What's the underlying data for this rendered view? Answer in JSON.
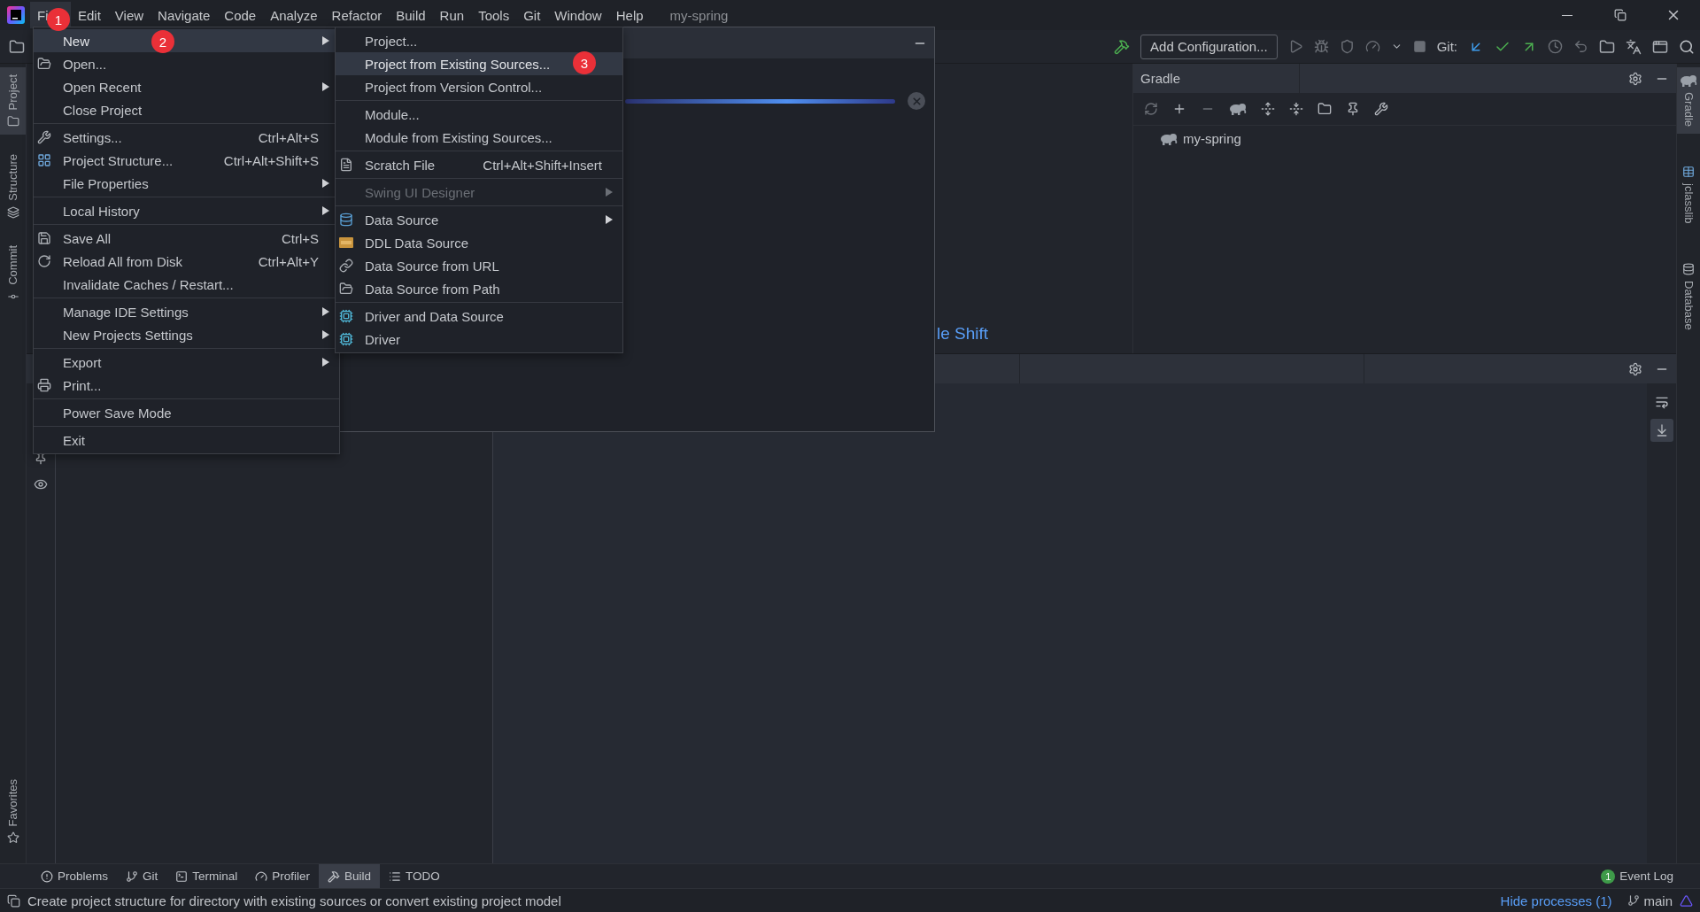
{
  "window": {
    "title": "my-spring"
  },
  "menu_bar": [
    {
      "label": "Fi",
      "selected": true
    },
    {
      "label": "Edit",
      "selected": false
    },
    {
      "label": "View",
      "selected": false
    },
    {
      "label": "Navigate",
      "selected": false
    },
    {
      "label": "Code",
      "selected": false
    },
    {
      "label": "Analyze",
      "selected": false
    },
    {
      "label": "Refactor",
      "selected": false
    },
    {
      "label": "Build",
      "selected": false
    },
    {
      "label": "Run",
      "selected": false
    },
    {
      "label": "Tools",
      "selected": false
    },
    {
      "label": "Git",
      "selected": false
    },
    {
      "label": "Window",
      "selected": false
    },
    {
      "label": "Help",
      "selected": false
    }
  ],
  "toolbar": {
    "run_config": "Add Configuration...",
    "vcs_label": "Git:"
  },
  "left_stripe": [
    {
      "label": "Project",
      "selected": true
    },
    {
      "label": "Structure",
      "selected": false
    },
    {
      "label": "Commit",
      "selected": false
    },
    {
      "label": "Favorites",
      "selected": false
    }
  ],
  "right_stripe": [
    {
      "label": "Gradle",
      "selected": true
    },
    {
      "label": "jclasslib",
      "selected": false
    },
    {
      "label": "Database",
      "selected": false
    }
  ],
  "editor": {
    "hint": "le Shift"
  },
  "gradle": {
    "title": "Gradle",
    "tree": [
      {
        "label": "my-spring"
      }
    ]
  },
  "file_menu": {
    "groups": [
      [
        {
          "label": "New",
          "submenu": true,
          "selected": true
        },
        {
          "label": "Open...",
          "submenu": false,
          "selected": false
        },
        {
          "label": "Open Recent",
          "submenu": true,
          "selected": false
        },
        {
          "label": "Close Project",
          "submenu": false,
          "selected": false
        }
      ],
      [
        {
          "label": "Settings...",
          "shortcut": "Ctrl+Alt+S",
          "submenu": false,
          "selected": false
        },
        {
          "label": "Project Structure...",
          "shortcut": "Ctrl+Alt+Shift+S",
          "submenu": false,
          "selected": false
        },
        {
          "label": "File Properties",
          "submenu": true,
          "selected": false
        }
      ],
      [
        {
          "label": "Local History",
          "submenu": true,
          "selected": false
        }
      ],
      [
        {
          "label": "Save All",
          "shortcut": "Ctrl+S",
          "submenu": false,
          "selected": false
        },
        {
          "label": "Reload All from Disk",
          "shortcut": "Ctrl+Alt+Y",
          "submenu": false,
          "selected": false
        },
        {
          "label": "Invalidate Caches / Restart...",
          "submenu": false,
          "selected": false
        }
      ],
      [
        {
          "label": "Manage IDE Settings",
          "submenu": true,
          "selected": false
        },
        {
          "label": "New Projects Settings",
          "submenu": true,
          "selected": false
        }
      ],
      [
        {
          "label": "Export",
          "submenu": true,
          "selected": false
        },
        {
          "label": "Print...",
          "submenu": false,
          "selected": false
        }
      ],
      [
        {
          "label": "Power Save Mode",
          "submenu": false,
          "selected": false
        }
      ],
      [
        {
          "label": "Exit",
          "submenu": false,
          "selected": false
        }
      ]
    ]
  },
  "new_submenu": {
    "groups": [
      [
        {
          "label": "Project...",
          "submenu": false,
          "selected": false,
          "disabled": false
        },
        {
          "label": "Project from Existing Sources...",
          "submenu": false,
          "selected": true,
          "disabled": false
        },
        {
          "label": "Project from Version Control...",
          "submenu": false,
          "selected": false,
          "disabled": false
        }
      ],
      [
        {
          "label": "Module...",
          "submenu": false,
          "selected": false,
          "disabled": false
        },
        {
          "label": "Module from Existing Sources...",
          "submenu": false,
          "selected": false,
          "disabled": false
        }
      ],
      [
        {
          "label": "Scratch File",
          "shortcut": "Ctrl+Alt+Shift+Insert",
          "submenu": false,
          "selected": false,
          "disabled": false
        }
      ],
      [
        {
          "label": "Swing UI Designer",
          "submenu": true,
          "selected": false,
          "disabled": true
        }
      ],
      [
        {
          "label": "Data Source",
          "submenu": true,
          "selected": false,
          "disabled": false
        },
        {
          "label": "DDL Data Source",
          "submenu": false,
          "selected": false,
          "disabled": false
        },
        {
          "label": "Data Source from URL",
          "submenu": false,
          "selected": false,
          "disabled": false
        },
        {
          "label": "Data Source from Path",
          "submenu": false,
          "selected": false,
          "disabled": false
        }
      ],
      [
        {
          "label": "Driver and Data Source",
          "submenu": false,
          "selected": false,
          "disabled": false
        },
        {
          "label": "Driver",
          "submenu": false,
          "selected": false,
          "disabled": false
        }
      ]
    ]
  },
  "markers": [
    "1",
    "2",
    "3"
  ],
  "bottom_tabs": [
    {
      "label": "Problems",
      "selected": false
    },
    {
      "label": "Git",
      "selected": false
    },
    {
      "label": "Terminal",
      "selected": false
    },
    {
      "label": "Profiler",
      "selected": false
    },
    {
      "label": "Build",
      "selected": true
    },
    {
      "label": "TODO",
      "selected": false
    }
  ],
  "event_log": {
    "label": "Event Log",
    "count": "1"
  },
  "status_bar": {
    "message": "Create project structure for directory with existing sources or convert existing project model",
    "link": "Hide processes (1)",
    "branch": "main"
  }
}
